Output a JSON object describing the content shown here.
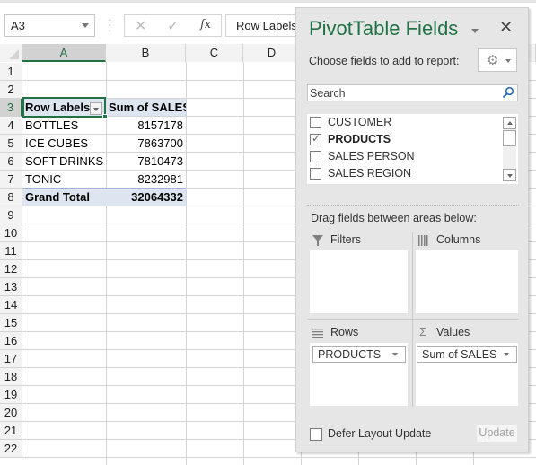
{
  "formula_bar": {
    "name_box": "A3",
    "cancel_icon": "✕",
    "enter_icon": "✓",
    "insert_function_label": "fx",
    "formula_value": "Row Labels"
  },
  "sheet": {
    "columns": [
      "A",
      "B",
      "C",
      "D"
    ],
    "selected_column": "A",
    "rows": [
      "1",
      "2",
      "3",
      "4",
      "5",
      "6",
      "7",
      "8",
      "9",
      "10",
      "11",
      "12",
      "13",
      "14",
      "15",
      "16",
      "17",
      "18",
      "19",
      "20",
      "21",
      "22"
    ],
    "selected_row": "3",
    "selected_cell": "A3"
  },
  "pivot_table": {
    "header": {
      "row_labels": "Row Labels",
      "value_header": "Sum of SALES"
    },
    "rows": [
      {
        "label": "BOTTLES",
        "value": "8157178"
      },
      {
        "label": "ICE CUBES",
        "value": "7863700"
      },
      {
        "label": "SOFT DRINKS",
        "value": "7810473"
      },
      {
        "label": "TONIC",
        "value": "8232981"
      }
    ],
    "grand_total": {
      "label": "Grand Total",
      "value": "32064332"
    }
  },
  "pivot_panel": {
    "title": "PivotTable Fields",
    "close_icon": "✕",
    "choose_label": "Choose fields to add to report:",
    "gear_icon": "⚙",
    "search_placeholder": "Search",
    "fields": [
      {
        "name": "CUSTOMER",
        "checked": false
      },
      {
        "name": "PRODUCTS",
        "checked": true
      },
      {
        "name": "SALES PERSON",
        "checked": false
      },
      {
        "name": "SALES REGION",
        "checked": false
      }
    ],
    "drag_label": "Drag fields between areas below:",
    "areas": {
      "filters": {
        "title": "Filters",
        "icon": "filter-icon",
        "items": []
      },
      "columns": {
        "title": "Columns",
        "icon": "columns-icon",
        "items": []
      },
      "rows": {
        "title": "Rows",
        "icon": "rows-icon",
        "items": [
          "PRODUCTS"
        ]
      },
      "values": {
        "title": "Values",
        "icon": "sigma-icon",
        "glyph": "Σ",
        "items": [
          "Sum of SALES"
        ]
      }
    },
    "defer_label": "Defer Layout Update",
    "defer_checked": false,
    "update_label": "Update"
  },
  "colors": {
    "excel_green": "#217346",
    "pivot_band": "#dde6f0",
    "panel_bg": "#e6e6e6"
  }
}
